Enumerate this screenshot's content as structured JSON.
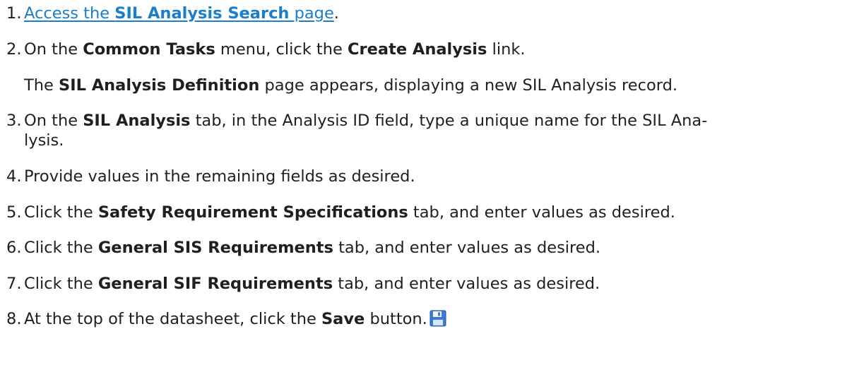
{
  "steps": [
    {
      "number": "1.",
      "link_pre": "Access the ",
      "link_bold": "SIL Analysis Search",
      "link_post": " page",
      "after": "."
    },
    {
      "number": "2.",
      "pre": "On the ",
      "bold1": "Common Tasks",
      "mid": " menu, click the ",
      "bold2": "Create Analysis",
      "post": " link."
    },
    {
      "pre": "The ",
      "bold1": "SIL Analysis Definition",
      "post": " page appears, displaying a new SIL Analysis record."
    },
    {
      "number": "3.",
      "pre": "On the ",
      "bold1": "SIL Analysis",
      "post_line1": " tab, in the Analysis ID field, type a unique name for the SIL Ana-",
      "line2": "lysis."
    },
    {
      "number": "4.",
      "text": "Provide values in the remaining fields as desired."
    },
    {
      "number": "5.",
      "pre": "Click the ",
      "bold1": "Safety Requirement Specifications",
      "post": " tab, and enter values as desired."
    },
    {
      "number": "6.",
      "pre": "Click the ",
      "bold1": "General SIS Requirements",
      "post": " tab, and enter values as desired."
    },
    {
      "number": "7.",
      "pre": "Click the ",
      "bold1": "General SIF Requirements",
      "post": " tab, and enter values as desired."
    },
    {
      "number": "8.",
      "pre": "At the top of the datasheet, click the ",
      "bold1": "Save",
      "post": " button.",
      "icon": "save-icon"
    }
  ],
  "colors": {
    "link": "#1a7ecb",
    "text": "#1f1f1f",
    "save_icon": "#3a7bd5"
  }
}
